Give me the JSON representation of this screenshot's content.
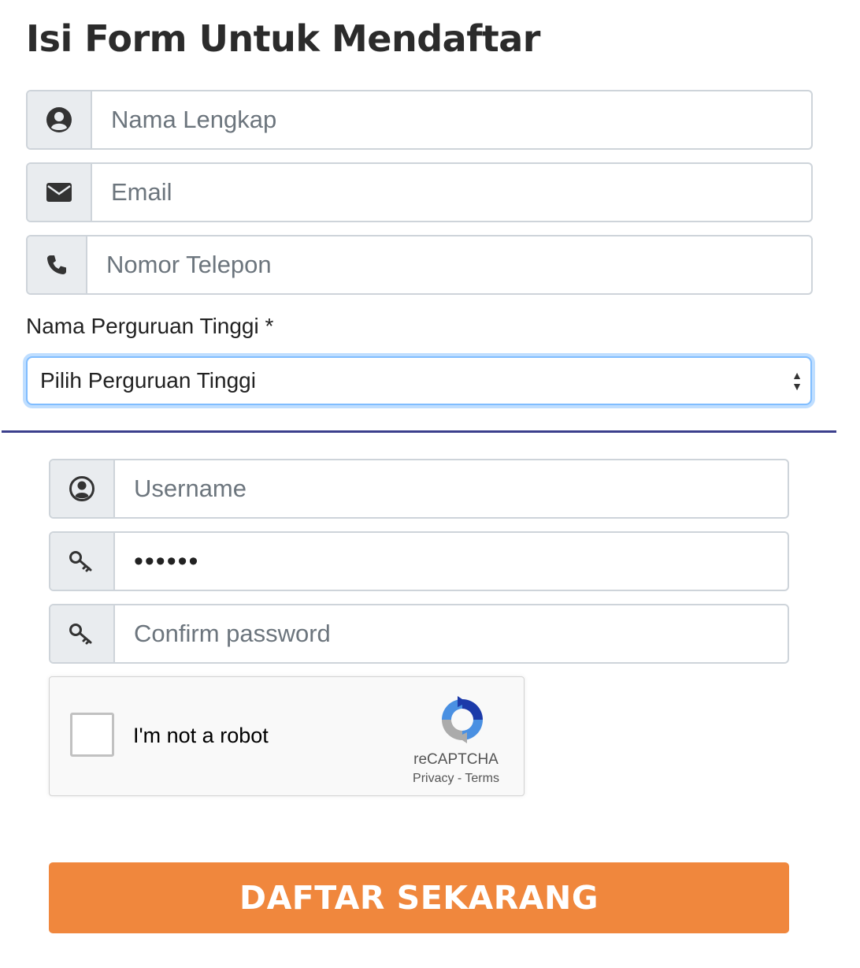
{
  "form_title": "Isi Form Untuk Mendaftar",
  "fields": {
    "full_name": {
      "icon": "user-circle-icon",
      "placeholder": "Nama Lengkap"
    },
    "email": {
      "icon": "envelope-icon",
      "placeholder": "Email"
    },
    "phone": {
      "icon": "phone-icon",
      "placeholder": "Nomor Telepon"
    }
  },
  "university": {
    "label": "Nama Perguruan Tinggi *",
    "selected": "Pilih Perguruan Tinggi"
  },
  "account": {
    "username": {
      "icon": "user-circle-icon",
      "placeholder": "Username"
    },
    "password": {
      "icon": "key-icon",
      "value": "••••••"
    },
    "confirm_password": {
      "icon": "key-icon",
      "placeholder": "Confirm password"
    }
  },
  "recaptcha": {
    "label": "I'm not a robot",
    "brand": "reCAPTCHA",
    "privacy": "Privacy",
    "separator": " - ",
    "terms": "Terms"
  },
  "submit_label": "DAFTAR SEKARANG",
  "colors": {
    "submit": "#f0873d",
    "divider": "#3b3f8c",
    "focus": "#80bdff",
    "addon_bg": "#e9ecef"
  }
}
